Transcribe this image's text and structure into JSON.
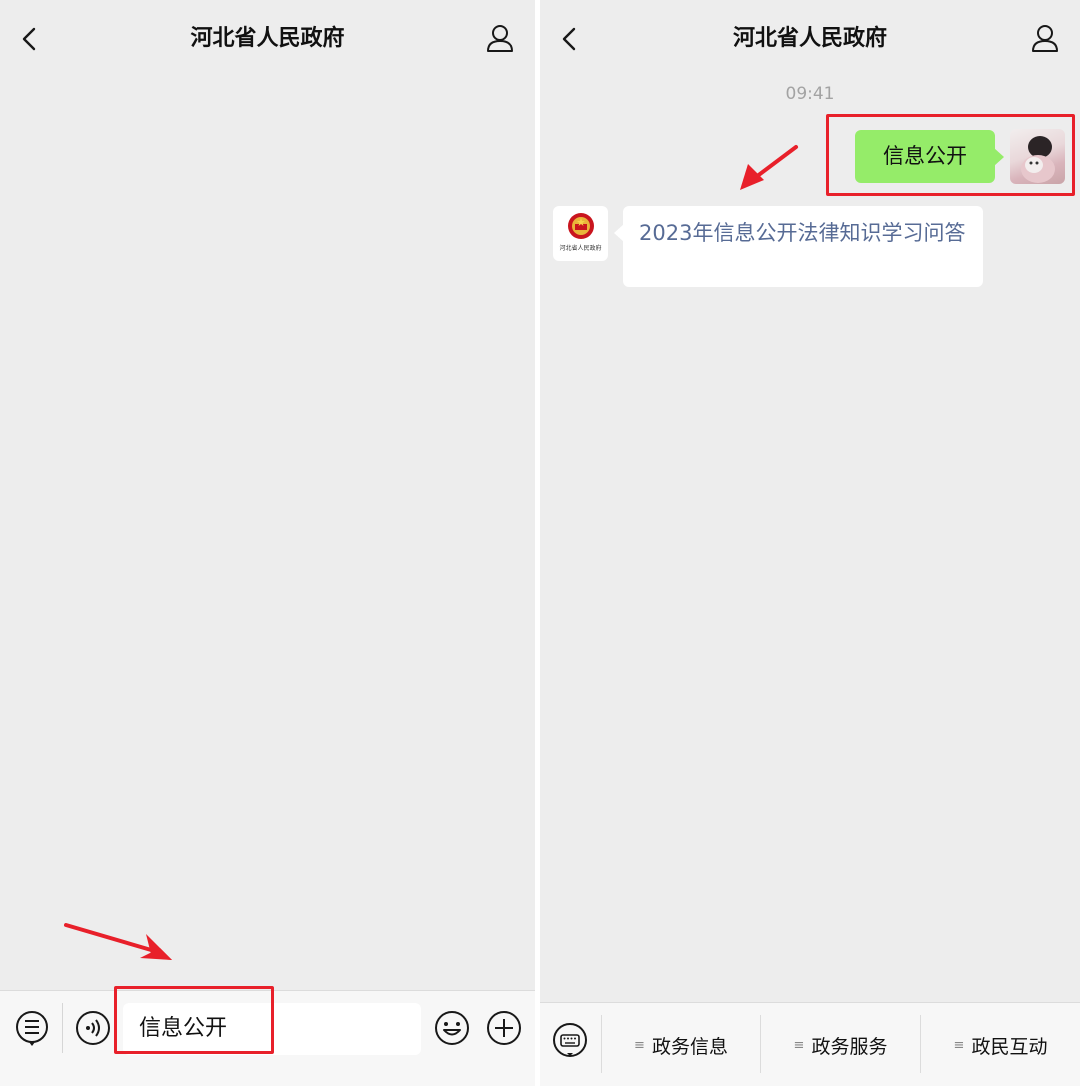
{
  "left": {
    "nav": {
      "title": "河北省人民政府"
    },
    "input_value": "信息公开"
  },
  "right": {
    "nav": {
      "title": "河北省人民政府"
    },
    "timestamp": "09:41",
    "sent_message": "信息公开",
    "reply_message": "2023年信息公开法律知识学习问答",
    "gov_avatar_caption": "河北省人民政府",
    "menu": [
      {
        "icon": "≡",
        "label": "政务信息"
      },
      {
        "icon": "≡",
        "label": "政务服务"
      },
      {
        "icon": "≡",
        "label": "政民互动"
      }
    ]
  },
  "colors": {
    "highlight": "#e8202a",
    "sent_bubble": "#95ec69",
    "link_text": "#576b95",
    "background": "#ededed"
  }
}
